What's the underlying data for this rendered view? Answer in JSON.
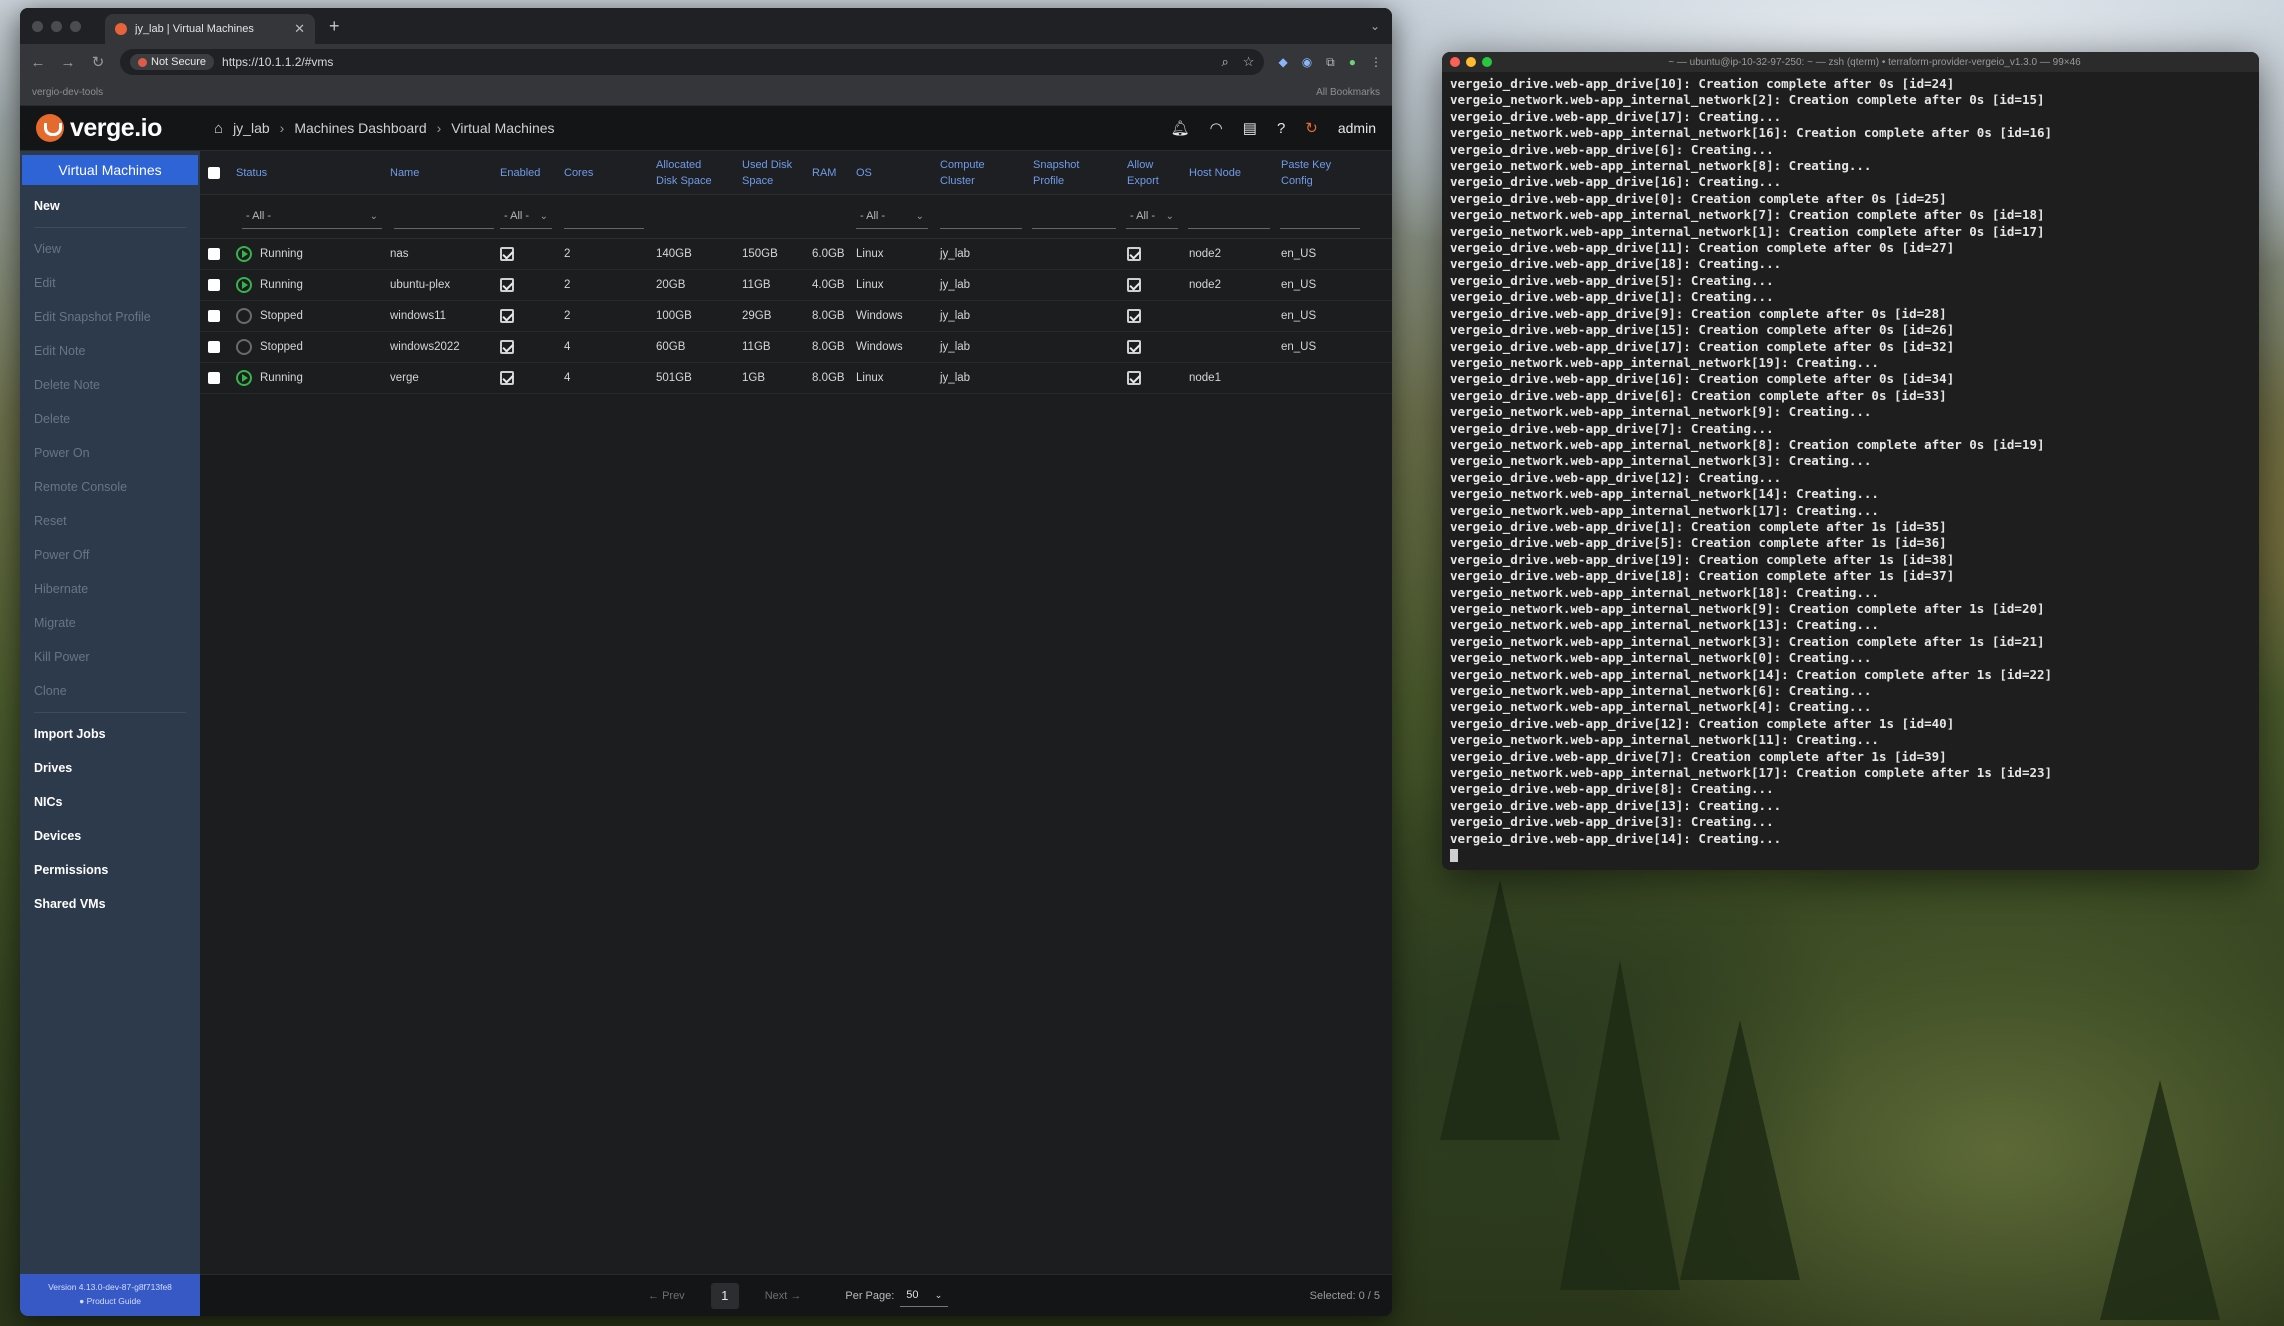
{
  "browser": {
    "tab_title": "jy_lab | Virtual Machines",
    "not_secure": "Not Secure",
    "url": "https://10.1.1.2/#vms",
    "bookmark_left": "vergio-dev-tools",
    "bookmark_right": "All Bookmarks"
  },
  "app": {
    "logo": "verge.io",
    "breadcrumbs": [
      "jy_lab",
      "Machines Dashboard",
      "Virtual Machines"
    ],
    "user": "admin"
  },
  "sidebar": {
    "active": "Virtual Machines",
    "new_label": "New",
    "actions": [
      "View",
      "Edit",
      "Edit Snapshot Profile",
      "Edit Note",
      "Delete Note",
      "Delete",
      "Power On",
      "Remote Console",
      "Reset",
      "Power Off",
      "Hibernate",
      "Migrate",
      "Kill Power",
      "Clone"
    ],
    "links": [
      "Import Jobs",
      "Drives",
      "NICs",
      "Devices",
      "Permissions",
      "Shared VMs"
    ],
    "footer_version": "Version 4.13.0-dev-87-g8f713fe8",
    "footer_link": "Product Guide"
  },
  "table": {
    "headers": {
      "status": "Status",
      "name": "Name",
      "enabled": "Enabled",
      "cores": "Cores",
      "alloc1": "Allocated",
      "alloc2": "Disk Space",
      "used1": "Used Disk",
      "used2": "Space",
      "ram": "RAM",
      "os": "OS",
      "cluster1": "Compute",
      "cluster2": "Cluster",
      "snap1": "Snapshot",
      "snap2": "Profile",
      "export1": "Allow",
      "export2": "Export",
      "host": "Host Node",
      "paste1": "Paste Key",
      "paste2": "Config"
    },
    "filter_all": "- All -",
    "rows": [
      {
        "status": "Running",
        "state": "running",
        "name": "nas",
        "cores": "2",
        "alloc": "140GB",
        "used": "150GB",
        "ram": "6.0GB",
        "os": "Linux",
        "cluster": "jy_lab",
        "host": "node2",
        "paste": "en_US"
      },
      {
        "status": "Running",
        "state": "running",
        "name": "ubuntu-plex",
        "cores": "2",
        "alloc": "20GB",
        "used": "11GB",
        "ram": "4.0GB",
        "os": "Linux",
        "cluster": "jy_lab",
        "host": "node2",
        "paste": "en_US"
      },
      {
        "status": "Stopped",
        "state": "stopped",
        "name": "windows11",
        "cores": "2",
        "alloc": "100GB",
        "used": "29GB",
        "ram": "8.0GB",
        "os": "Windows",
        "cluster": "jy_lab",
        "host": "",
        "paste": "en_US"
      },
      {
        "status": "Stopped",
        "state": "stopped",
        "name": "windows2022",
        "cores": "4",
        "alloc": "60GB",
        "used": "11GB",
        "ram": "8.0GB",
        "os": "Windows",
        "cluster": "jy_lab",
        "host": "",
        "paste": "en_US"
      },
      {
        "status": "Running",
        "state": "running",
        "name": "verge",
        "cores": "4",
        "alloc": "501GB",
        "used": "1GB",
        "ram": "8.0GB",
        "os": "Linux",
        "cluster": "jy_lab",
        "host": "node1",
        "paste": ""
      }
    ],
    "pager": {
      "prev": "Prev",
      "page": "1",
      "next": "Next",
      "per_page_label": "Per Page:",
      "per_page": "50",
      "selected": "Selected: 0 / 5"
    }
  },
  "terminal": {
    "title": "~ — ubuntu@ip-10-32-97-250: ~ — zsh (qterm) • terraform-provider-vergeio_v1.3.0 — 99×46",
    "lines": [
      "vergeio_drive.web-app_drive[10]: Creation complete after 0s [id=24]",
      "vergeio_network.web-app_internal_network[2]: Creation complete after 0s [id=15]",
      "vergeio_drive.web-app_drive[17]: Creating...",
      "vergeio_network.web-app_internal_network[16]: Creation complete after 0s [id=16]",
      "vergeio_drive.web-app_drive[6]: Creating...",
      "vergeio_network.web-app_internal_network[8]: Creating...",
      "vergeio_drive.web-app_drive[16]: Creating...",
      "vergeio_drive.web-app_drive[0]: Creation complete after 0s [id=25]",
      "vergeio_network.web-app_internal_network[7]: Creation complete after 0s [id=18]",
      "vergeio_network.web-app_internal_network[1]: Creation complete after 0s [id=17]",
      "vergeio_drive.web-app_drive[11]: Creation complete after 0s [id=27]",
      "vergeio_drive.web-app_drive[18]: Creating...",
      "vergeio_drive.web-app_drive[5]: Creating...",
      "vergeio_drive.web-app_drive[1]: Creating...",
      "vergeio_drive.web-app_drive[9]: Creation complete after 0s [id=28]",
      "vergeio_drive.web-app_drive[15]: Creation complete after 0s [id=26]",
      "vergeio_drive.web-app_drive[17]: Creation complete after 0s [id=32]",
      "vergeio_network.web-app_internal_network[19]: Creating...",
      "vergeio_drive.web-app_drive[16]: Creation complete after 0s [id=34]",
      "vergeio_drive.web-app_drive[6]: Creation complete after 0s [id=33]",
      "vergeio_network.web-app_internal_network[9]: Creating...",
      "vergeio_drive.web-app_drive[7]: Creating...",
      "vergeio_network.web-app_internal_network[8]: Creation complete after 0s [id=19]",
      "vergeio_network.web-app_internal_network[3]: Creating...",
      "vergeio_drive.web-app_drive[12]: Creating...",
      "vergeio_network.web-app_internal_network[14]: Creating...",
      "vergeio_network.web-app_internal_network[17]: Creating...",
      "vergeio_drive.web-app_drive[1]: Creation complete after 1s [id=35]",
      "vergeio_drive.web-app_drive[5]: Creation complete after 1s [id=36]",
      "vergeio_drive.web-app_drive[19]: Creation complete after 1s [id=38]",
      "vergeio_drive.web-app_drive[18]: Creation complete after 1s [id=37]",
      "vergeio_network.web-app_internal_network[18]: Creating...",
      "vergeio_network.web-app_internal_network[9]: Creation complete after 1s [id=20]",
      "vergeio_network.web-app_internal_network[13]: Creating...",
      "vergeio_network.web-app_internal_network[3]: Creation complete after 1s [id=21]",
      "vergeio_network.web-app_internal_network[0]: Creating...",
      "vergeio_network.web-app_internal_network[14]: Creation complete after 1s [id=22]",
      "vergeio_network.web-app_internal_network[6]: Creating...",
      "vergeio_network.web-app_internal_network[4]: Creating...",
      "vergeio_drive.web-app_drive[12]: Creation complete after 1s [id=40]",
      "vergeio_network.web-app_internal_network[11]: Creating...",
      "vergeio_drive.web-app_drive[7]: Creation complete after 1s [id=39]",
      "vergeio_network.web-app_internal_network[17]: Creation complete after 1s [id=23]",
      "vergeio_drive.web-app_drive[8]: Creating...",
      "vergeio_drive.web-app_drive[13]: Creating...",
      "vergeio_drive.web-app_drive[3]: Creating...",
      "vergeio_drive.web-app_drive[14]: Creating..."
    ]
  },
  "colors": {
    "accent": "#2f64d6",
    "brand": "#e46a2e",
    "running": "#37b34a",
    "sidebar": "#2d3a4b"
  }
}
